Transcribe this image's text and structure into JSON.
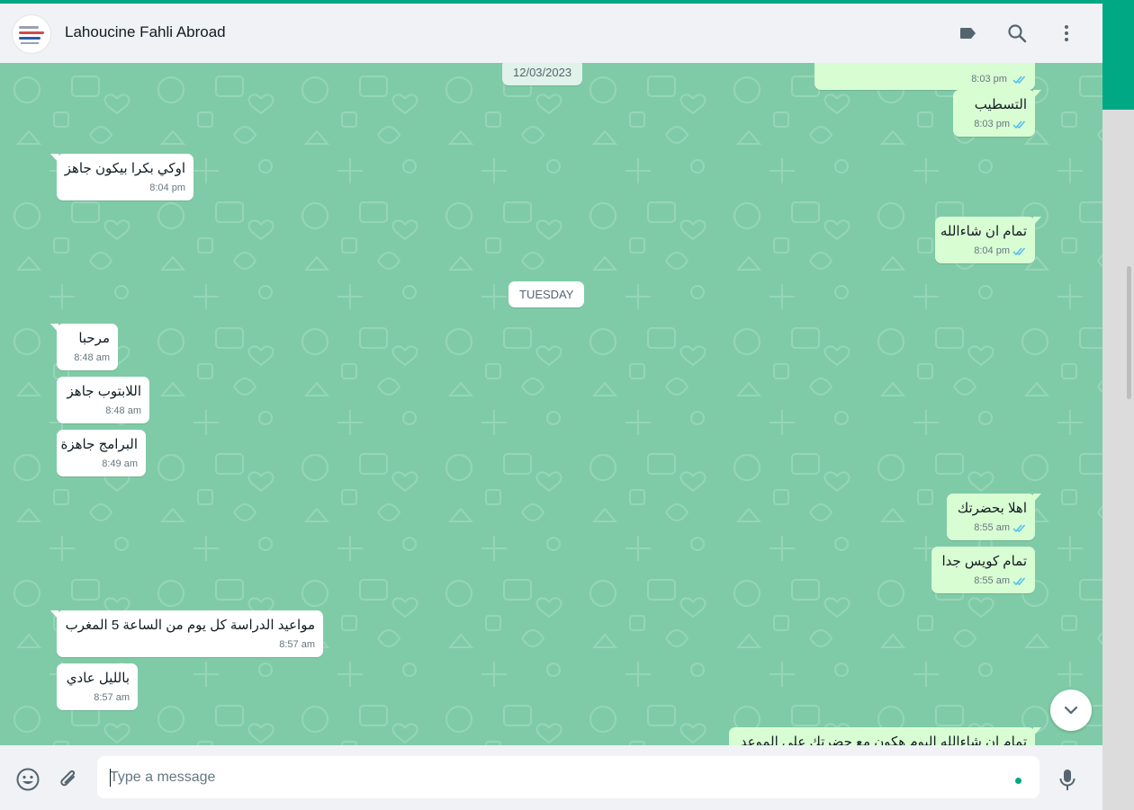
{
  "header": {
    "title": "Lahoucine Fahli Abroad",
    "icons": [
      "label-icon",
      "search-icon",
      "more-vertical-icon"
    ]
  },
  "date_chips": [
    "12/03/2023",
    "TUESDAY"
  ],
  "messages": [
    {
      "dir": "out",
      "text": "",
      "time": "8:03 pm",
      "status": "read"
    },
    {
      "dir": "out",
      "text": "التسطيب",
      "time": "8:03 pm",
      "status": "read"
    },
    {
      "dir": "in",
      "text": "اوكي بكرا بيكون جاهز",
      "time": "8:04 pm"
    },
    {
      "dir": "out",
      "text": "تمام ان شاءالله",
      "time": "8:04 pm",
      "status": "read"
    },
    {
      "dir": "in",
      "text": "مرحبا",
      "time": "8:48 am"
    },
    {
      "dir": "in",
      "text": "اللابتوب جاهز",
      "time": "8:48 am"
    },
    {
      "dir": "in",
      "text": "البرامج جاهزة",
      "time": "8:49 am"
    },
    {
      "dir": "out",
      "text": "اهلا بحضرتك",
      "time": "8:55 am",
      "status": "read"
    },
    {
      "dir": "out",
      "text": "تمام كويس جدا",
      "time": "8:55 am",
      "status": "read"
    },
    {
      "dir": "in",
      "text": "مواعيد الدراسة كل يوم من الساعة 5 المغرب",
      "time": "8:57 am"
    },
    {
      "dir": "in",
      "text": "بالليل عادي",
      "time": "8:57 am"
    },
    {
      "dir": "out",
      "text": "تمام ان شاءالله اليوم هكون مع حضرتك على الموعد",
      "time": "",
      "status": ""
    }
  ],
  "footer": {
    "placeholder": "Type a message",
    "icons": [
      "emoji-icon",
      "attach-icon",
      "mic-icon"
    ]
  },
  "colors": {
    "accent": "#00a884",
    "chat_background": "#7fcba7",
    "incoming_bubble": "#ffffff",
    "outgoing_bubble": "#d9fdd3",
    "read_ticks": "#53bdeb"
  }
}
